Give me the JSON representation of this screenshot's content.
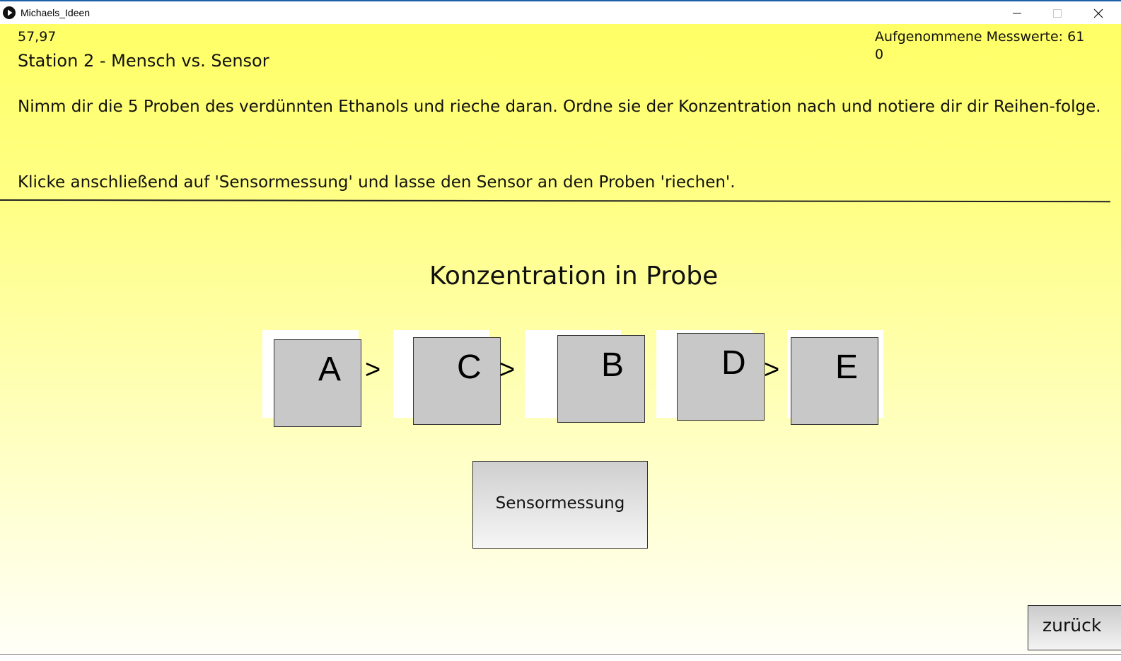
{
  "window": {
    "title": "Michaels_Ideen"
  },
  "header": {
    "fps": "57,97",
    "station_title": "Station 2 - Mensch vs. Sensor",
    "measurements_label": "Aufgenommene Messwerte: 61",
    "measurements_value": "0"
  },
  "instructions": {
    "line1": "Nimm dir die 5 Proben des verdünnten Ethanols und rieche daran. Ordne sie der Konzentration nach und notiere dir dir Reihen-folge.",
    "line2": "Klicke anschließend auf 'Sensormessung' und lasse den Sensor an den Proben 'riechen'."
  },
  "ranking": {
    "heading": "Konzentration in Probe",
    "boxes": [
      "A",
      "C",
      "B",
      "D",
      "E"
    ],
    "separator": ">"
  },
  "buttons": {
    "sensor": "Sensormessung",
    "back": "zurück"
  }
}
